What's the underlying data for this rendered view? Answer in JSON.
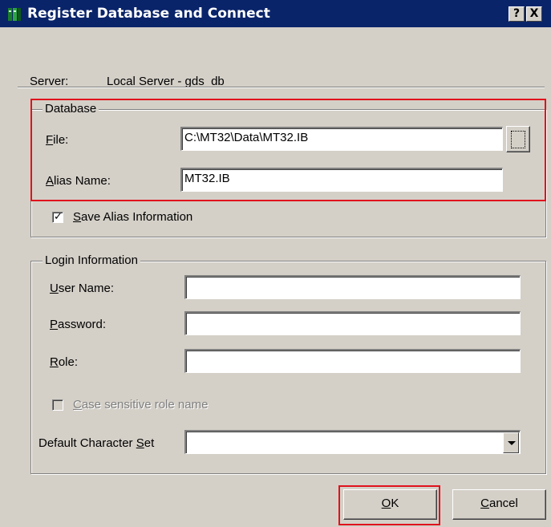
{
  "window": {
    "title": "Register Database and Connect",
    "help_button": "?",
    "close_button": "X",
    "icon": "database-server-icon"
  },
  "server": {
    "label": "Server:",
    "value": "Local Server - gds_db"
  },
  "database_group": {
    "title": "Database",
    "file_label_accel": "F",
    "file_label_rest": "ile:",
    "file_value": "C:\\MT32\\Data\\MT32.IB",
    "browse_icon": "browse-file-icon",
    "alias_label_accel": "A",
    "alias_label_rest": "lias Name:",
    "alias_value": "MT32.IB",
    "save_alias_checked": true,
    "save_alias_accel": "S",
    "save_alias_rest": "ave Alias Information"
  },
  "login_group": {
    "title": "Login Information",
    "user_label_accel": "U",
    "user_label_rest": "ser Name:",
    "user_value": "",
    "password_label_accel": "P",
    "password_label_rest": "assword:",
    "password_value": "",
    "role_label_accel": "R",
    "role_label_rest": "ole:",
    "role_value": "",
    "case_sensitive_checked": false,
    "case_sensitive_accel": "C",
    "case_sensitive_rest": "ase sensitive role name",
    "charset_label_pre": "Default Character ",
    "charset_label_accel": "S",
    "charset_label_rest": "et",
    "charset_value": ""
  },
  "buttons": {
    "ok_accel": "O",
    "ok_rest": "K",
    "cancel_accel": "C",
    "cancel_rest": "ancel"
  },
  "colors": {
    "titlebar": "#0a246a",
    "dialog_face": "#d4d0c8",
    "highlight": "#e0121c"
  }
}
